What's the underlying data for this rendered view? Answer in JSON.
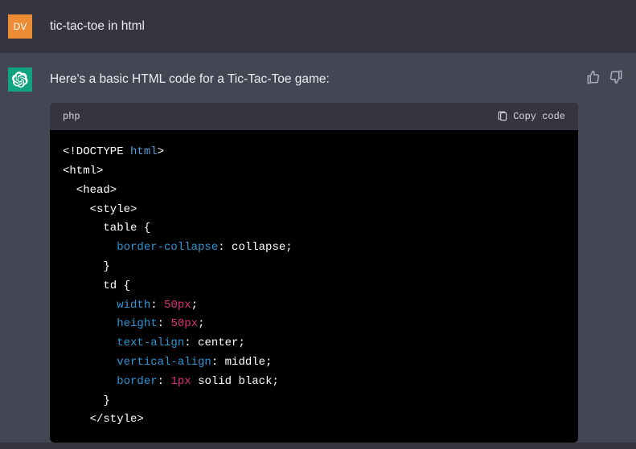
{
  "user": {
    "avatar": "DV",
    "message": "tic-tac-toe in html"
  },
  "assistant": {
    "intro": "Here's a basic HTML code for a Tic-Tac-Toe game:",
    "code": {
      "language": "php",
      "copy_label": "Copy code",
      "lines": [
        [
          {
            "c": "t-doctype",
            "t": "<!DOCTYPE "
          },
          {
            "c": "t-doctype-kw",
            "t": "html"
          },
          {
            "c": "t-doctype",
            "t": ">"
          }
        ],
        [
          {
            "c": "t-tag",
            "t": "<html>"
          }
        ],
        [
          {
            "c": "t-tag",
            "t": "  <head>"
          }
        ],
        [
          {
            "c": "t-tag",
            "t": "    <style>"
          }
        ],
        [
          {
            "c": "t-val",
            "t": "      table {"
          }
        ],
        [
          {
            "c": "t-val",
            "t": "        "
          },
          {
            "c": "t-prop",
            "t": "border-collapse"
          },
          {
            "c": "t-val",
            "t": ": collapse;"
          }
        ],
        [
          {
            "c": "t-val",
            "t": "      }"
          }
        ],
        [
          {
            "c": "t-val",
            "t": "      td {"
          }
        ],
        [
          {
            "c": "t-val",
            "t": "        "
          },
          {
            "c": "t-prop",
            "t": "width"
          },
          {
            "c": "t-val",
            "t": ": "
          },
          {
            "c": "t-num",
            "t": "50px"
          },
          {
            "c": "t-val",
            "t": ";"
          }
        ],
        [
          {
            "c": "t-val",
            "t": "        "
          },
          {
            "c": "t-prop",
            "t": "height"
          },
          {
            "c": "t-val",
            "t": ": "
          },
          {
            "c": "t-num",
            "t": "50px"
          },
          {
            "c": "t-val",
            "t": ";"
          }
        ],
        [
          {
            "c": "t-val",
            "t": "        "
          },
          {
            "c": "t-prop",
            "t": "text-align"
          },
          {
            "c": "t-val",
            "t": ": center;"
          }
        ],
        [
          {
            "c": "t-val",
            "t": "        "
          },
          {
            "c": "t-prop",
            "t": "vertical-align"
          },
          {
            "c": "t-val",
            "t": ": middle;"
          }
        ],
        [
          {
            "c": "t-val",
            "t": "        "
          },
          {
            "c": "t-prop",
            "t": "border"
          },
          {
            "c": "t-val",
            "t": ": "
          },
          {
            "c": "t-num",
            "t": "1px"
          },
          {
            "c": "t-val",
            "t": " solid black;"
          }
        ],
        [
          {
            "c": "t-val",
            "t": "      }"
          }
        ],
        [
          {
            "c": "t-tag",
            "t": "    </style>"
          }
        ]
      ]
    }
  }
}
